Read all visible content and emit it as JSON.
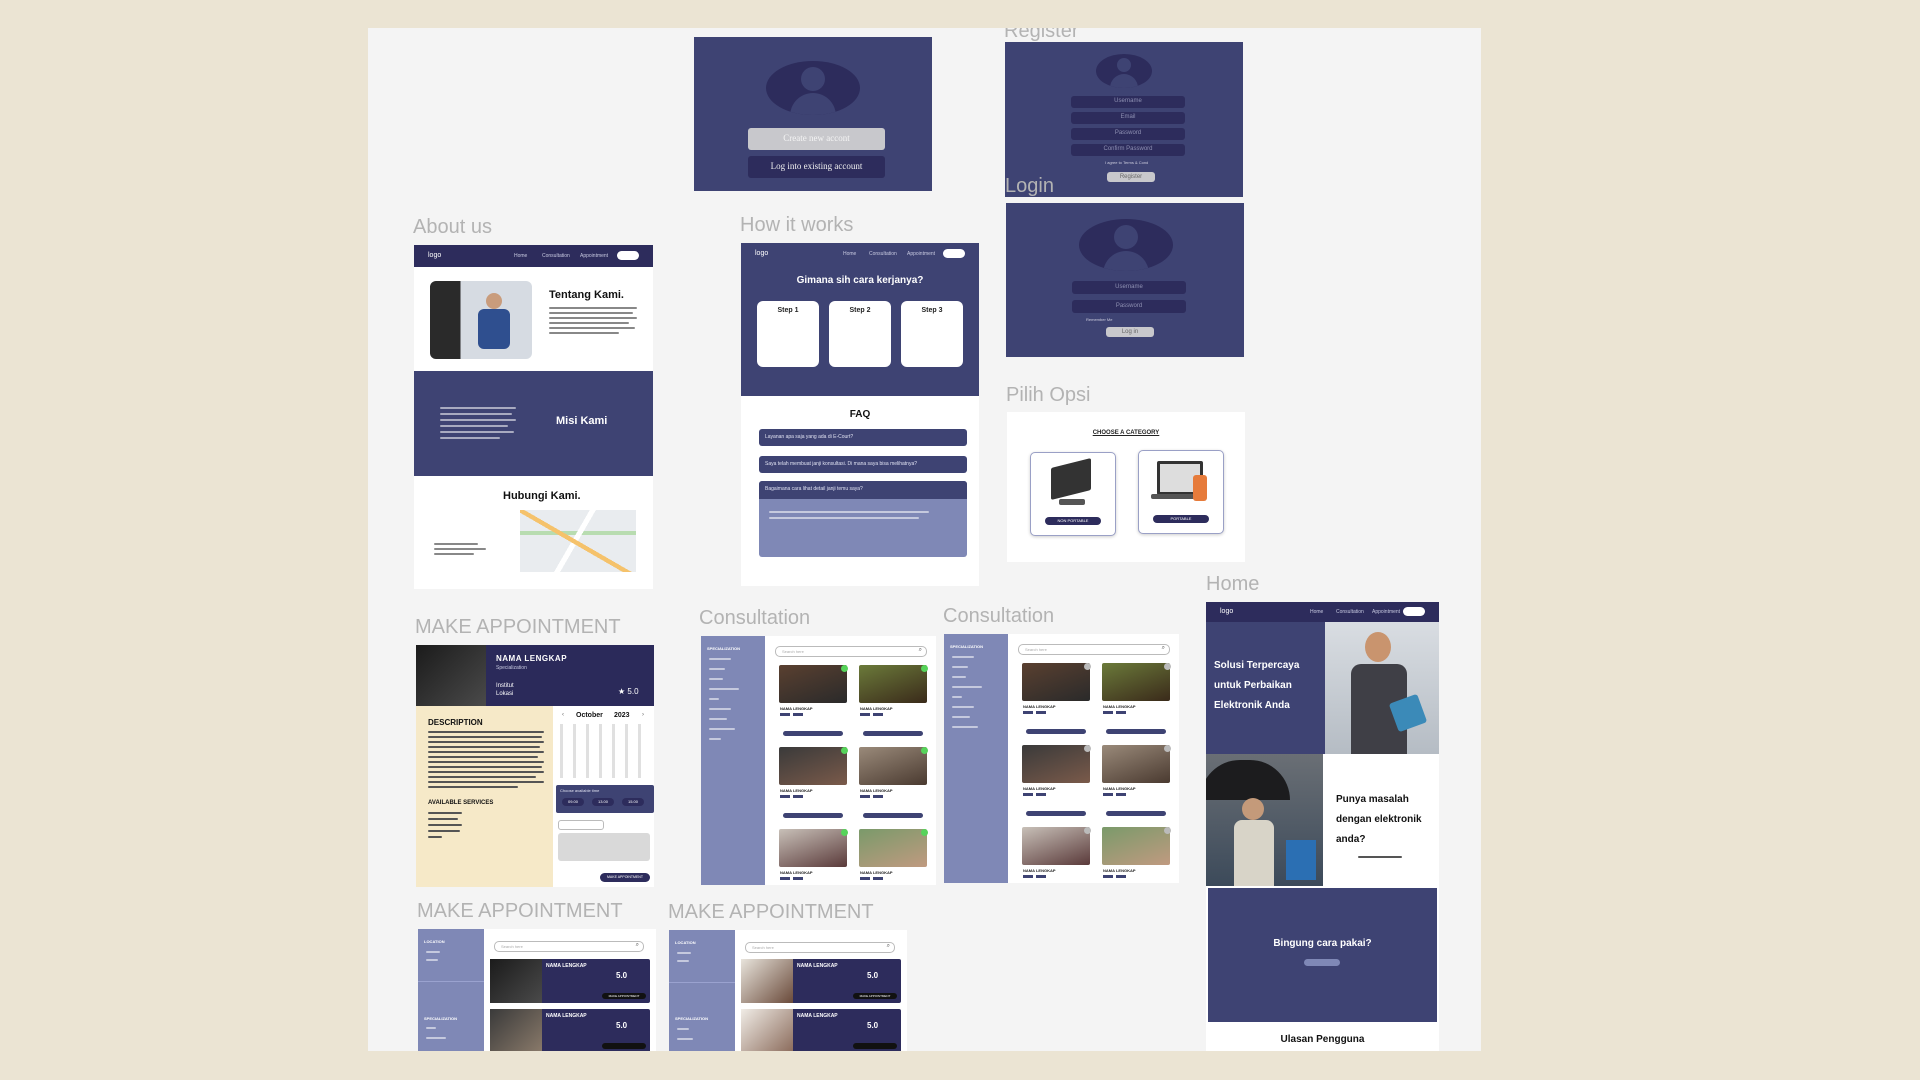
{
  "frames": {
    "landing": {
      "create_btn": "Create new accont",
      "login_btn": "Log into existing account"
    },
    "register": {
      "label": "Register",
      "fields": [
        "Username",
        "Email",
        "Password",
        "Confirm Password"
      ],
      "agree": "I agree to Terms & Cond",
      "submit": "Register"
    },
    "login": {
      "label": "Login",
      "fields": [
        "Username",
        "Password"
      ],
      "remember": "Remember Me",
      "submit": "Log in"
    },
    "pilih_opsi": {
      "label": "Pilih Opsi",
      "heading": "CHOOSE A CATEGORY",
      "option1": "NON PORTABLE",
      "option2": "PORTABLE"
    },
    "about": {
      "label": "About us",
      "logo": "logo",
      "nav": [
        "Home",
        "Consultation",
        "Appointment"
      ],
      "title": "Tentang Kami.",
      "mission": "Misi Kami",
      "contact": "Hubungi Kami."
    },
    "how": {
      "label": "How it works",
      "logo": "logo",
      "nav": [
        "Home",
        "Consultation",
        "Appointment"
      ],
      "title": "Gimana sih cara kerjanya?",
      "steps": [
        "Step 1",
        "Step 2",
        "Step 3"
      ],
      "faq": "FAQ",
      "questions": [
        "Layanan apa saja yang ada di E-Court?",
        "Saya telah membuat janji konsultasi. Di mana saya bisa melihatnya?",
        "Bagaimana cara lihat detail janji temu saya?"
      ]
    },
    "appointment": {
      "label": "MAKE APPOINTMENT",
      "name": "NAMA LENGKAP",
      "role": "Specialization",
      "institute": "Institut",
      "location": "Lokasi",
      "rating": "★ 5.0",
      "desc_title": "DESCRIPTION",
      "services_title": "AVAILABLE SERVICES",
      "month": "October",
      "year": "2023",
      "days": [
        "Sun",
        "Mon",
        "Tue",
        "Wed",
        "Thu",
        "Fri",
        "Sat"
      ],
      "times": [
        "09.00",
        "13.00",
        "15.00"
      ],
      "times_label": "Choose available time",
      "cta": "MAKE APPOINTMENT"
    },
    "consult1": {
      "label": "Consultation",
      "side_title": "SPECIALIZATION",
      "search": "Search here",
      "card_name": "NAMA LENGKAP"
    },
    "consult2": {
      "label": "Consultation",
      "side_title": "SPECIALIZATION",
      "search": "Search here",
      "card_name": "NAMA LENGKAP"
    },
    "home": {
      "label": "Home",
      "logo": "logo",
      "nav": [
        "Home",
        "Consultation",
        "Appointment"
      ],
      "hero": "Solusi Terpercaya untuk Perbaikan Elektronik Anda",
      "problem": "Punya masalah dengan elektronik anda?",
      "confused": "Bingung cara pakai?",
      "reviews": "Ulasan Pengguna"
    },
    "apt_list1": {
      "label": "MAKE APPOINTMENT",
      "side_title1": "LOCATION",
      "side_title2": "SPECIALIZATION",
      "search": "Search here",
      "name": "NAMA LENGKAP",
      "rating": "5.0",
      "cta": "MAKE APPOINTMENT"
    },
    "apt_list2": {
      "label": "MAKE APPOINTMENT",
      "side_title1": "LOCATION",
      "side_title2": "SPECIALIZATION",
      "search": "Search here",
      "name": "NAMA LENGKAP",
      "rating": "5.0",
      "cta": "MAKE APPOINTMENT"
    }
  },
  "colors": {
    "navy": "#3e4373",
    "dark_navy": "#2b2a5a",
    "lavender": "#7f88b6",
    "cream": "#f6e9c8",
    "canvas": "#f4f4f4",
    "page": "#ebe4d3"
  }
}
